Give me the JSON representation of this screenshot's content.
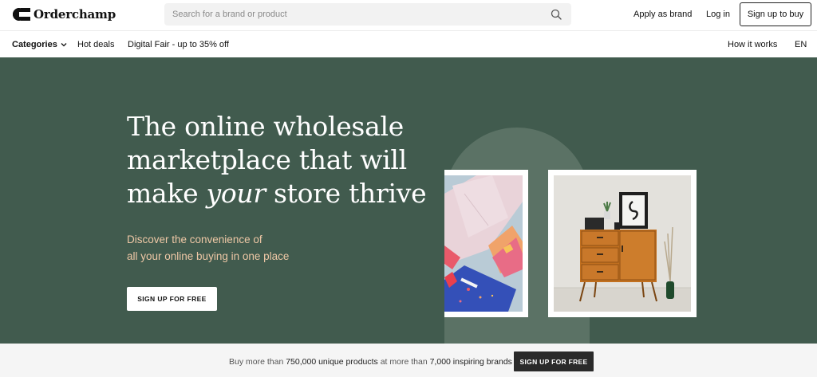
{
  "header": {
    "logo_text": "Orderchamp",
    "search_placeholder": "Search for a brand or product",
    "apply_label": "Apply as brand",
    "login_label": "Log in",
    "signup_label": "Sign up to buy"
  },
  "nav": {
    "categories_label": "Categories",
    "hot_deals_label": "Hot deals",
    "digital_fair_label": "Digital Fair - up to 35% off",
    "how_it_works_label": "How it works",
    "language_label": "EN"
  },
  "hero": {
    "title_line1": "The online wholesale",
    "title_line2": "marketplace that will",
    "title_line3_pre": "make ",
    "title_line3_em": "your",
    "title_line3_post": " store thrive",
    "subtitle_line1": "Discover the convenience of",
    "subtitle_line2": "all your online buying in one place",
    "cta_label": "SIGN UP FOR FREE"
  },
  "bottom_bar": {
    "text_1": "Buy more than ",
    "products_count": "750,000 unique products",
    "text_2": " at more than ",
    "brands_count": "7,000 inspiring brands",
    "cta_label": "SIGN UP FOR FREE"
  },
  "colors": {
    "hero_bg": "#415b4e",
    "arch": "#5b7265",
    "subtitle": "#efc8a6",
    "bottom_bg": "#f5f5f5",
    "bottom_btn": "#2a2a2a"
  },
  "icons": {
    "logo": "orderchamp-logo-icon",
    "search": "search-icon",
    "categories": "chevron-down-icon"
  }
}
